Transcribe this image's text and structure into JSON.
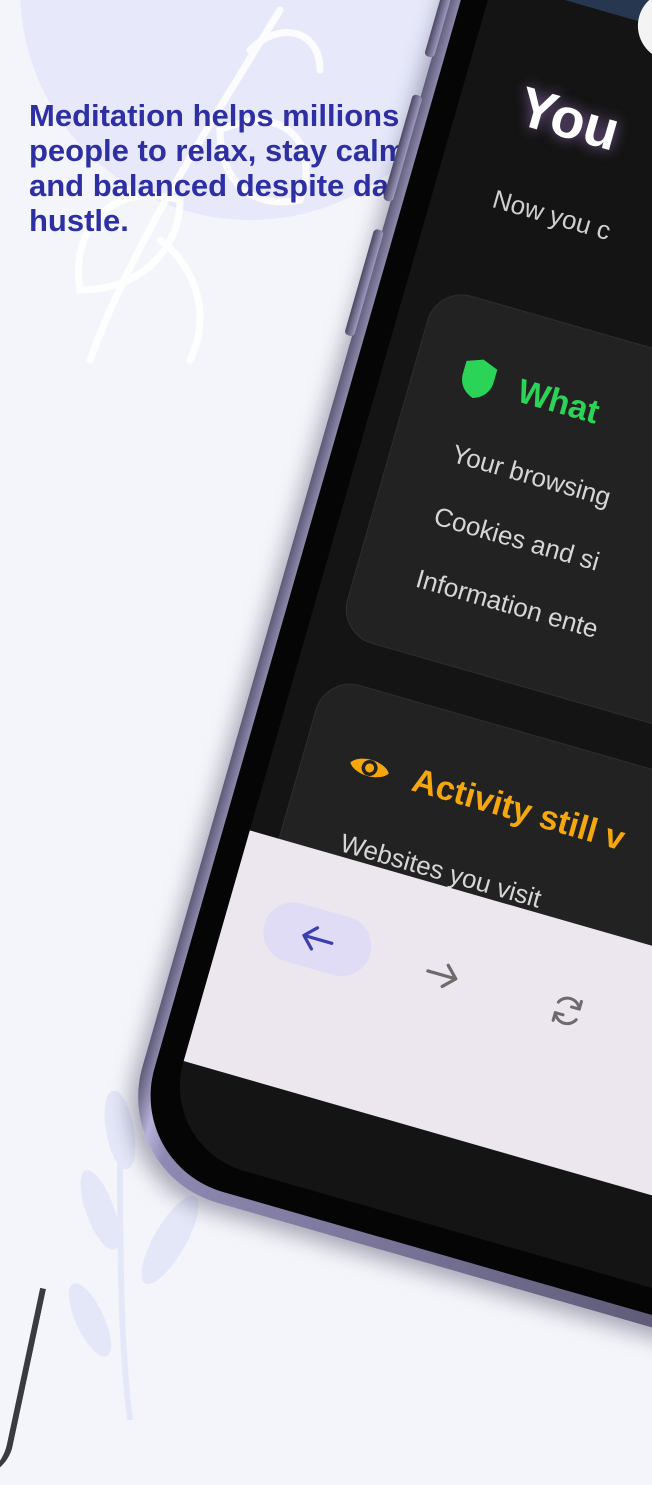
{
  "headline": "Meditation helps millions of people to relax, stay calm and balanced despite daily hustle.",
  "screen": {
    "title": "You",
    "subtitle": "Now you c",
    "card1": {
      "icon": "shield-icon",
      "title": "What",
      "items": [
        "Your browsing",
        "Cookies and si",
        "Information ente"
      ]
    },
    "card2": {
      "icon": "eye-icon",
      "title": "Activity still v",
      "items": [
        "Websites you visit"
      ]
    }
  },
  "nav": {
    "back": "arrow-left-icon",
    "forward": "arrow-right-icon",
    "reload": "refresh-icon"
  },
  "colors": {
    "headline": "#2d2fa3",
    "background": "#f4f5fa",
    "screen": "#141414",
    "card": "#222222",
    "green": "#2bd357",
    "orange": "#f5a70b",
    "nav_bar": "#ece6ef",
    "nav_active": "#e0dcf5",
    "nav_active_icon": "#3b3fae"
  }
}
